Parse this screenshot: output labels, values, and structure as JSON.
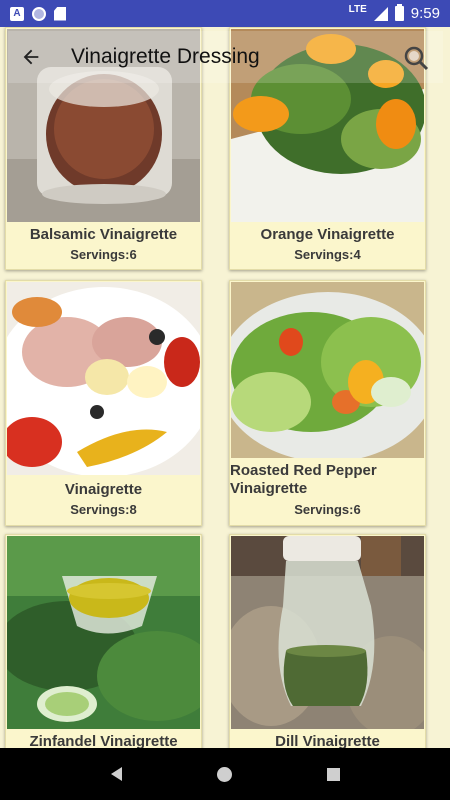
{
  "status_bar": {
    "time": "9:59",
    "network": "LTE",
    "icons": [
      "a-notification-icon",
      "circle-notification-icon",
      "sd-card-icon",
      "signal-icon",
      "battery-charging-icon"
    ]
  },
  "toolbar": {
    "title": "Vinaigrette Dressing",
    "back_icon": "arrow-left-icon",
    "search_icon": "search-icon"
  },
  "recipes": [
    {
      "title": "Balsamic Vinaigrette",
      "servings": "Servings:6"
    },
    {
      "title": "Orange Vinaigrette",
      "servings": "Servings:4"
    },
    {
      "title": "Vinaigrette",
      "servings": "Servings:8"
    },
    {
      "title": "Roasted Red Pepper Vinaigrette",
      "servings": "Servings:6"
    },
    {
      "title": "Zinfandel Vinaigrette",
      "servings": ""
    },
    {
      "title": "Dill Vinaigrette",
      "servings": ""
    }
  ],
  "nav_bar": {
    "icons": [
      "nav-back-icon",
      "nav-home-icon",
      "nav-recents-icon"
    ]
  },
  "colors": {
    "status_bar": "#3d4ab5",
    "background": "#f7f3d4",
    "card": "#fbf6cc",
    "text": "#3a3a3a"
  }
}
